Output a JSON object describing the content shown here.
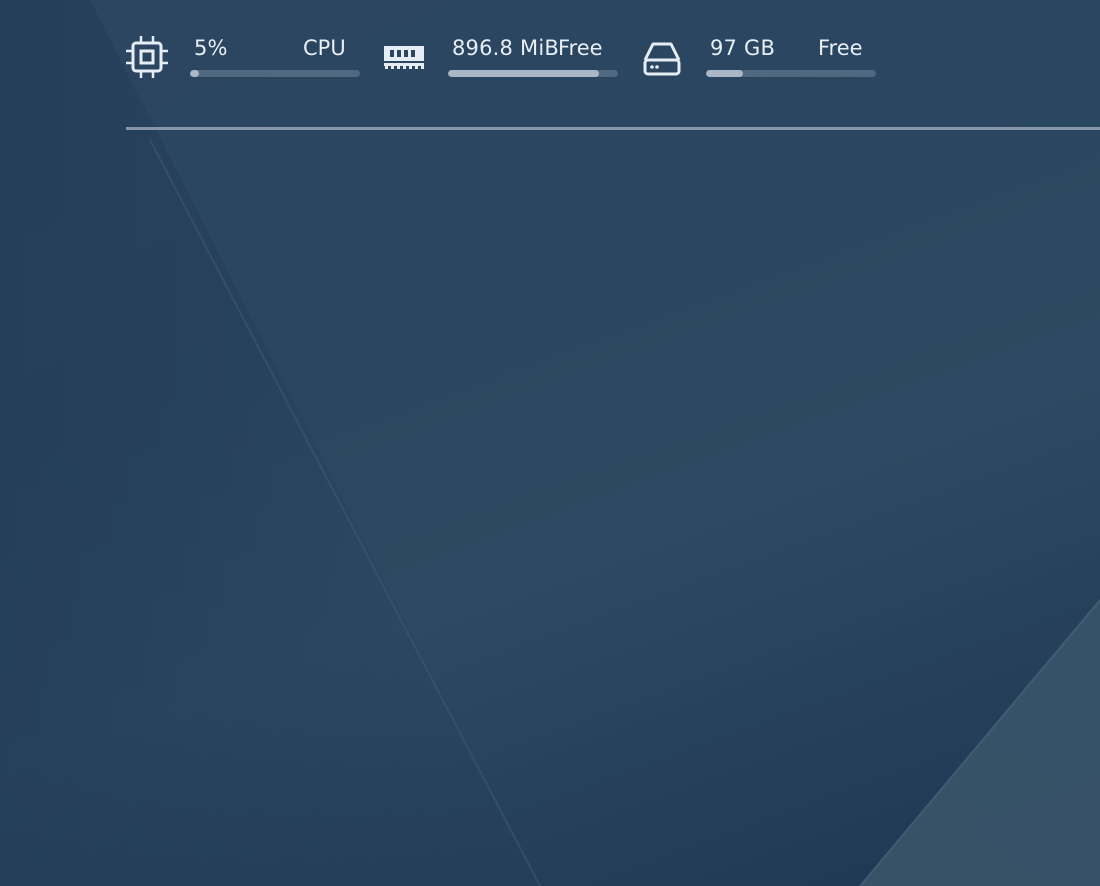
{
  "widgets": {
    "cpu": {
      "icon": "cpu-chip-icon",
      "value": "5%",
      "label": "CPU",
      "fill_fraction": 0.05
    },
    "memory": {
      "icon": "memory-ram-icon",
      "value": "896.8 MiB",
      "label": "Free",
      "fill_fraction": 0.89
    },
    "disk": {
      "icon": "hard-drive-icon",
      "value": "97 GB",
      "label": "Free",
      "fill_fraction": 0.22
    }
  },
  "colors": {
    "text": "#e8eef5",
    "bar_track": "#5b7288",
    "bar_fill": "#a9b7c6",
    "separator": "#8696a7"
  }
}
